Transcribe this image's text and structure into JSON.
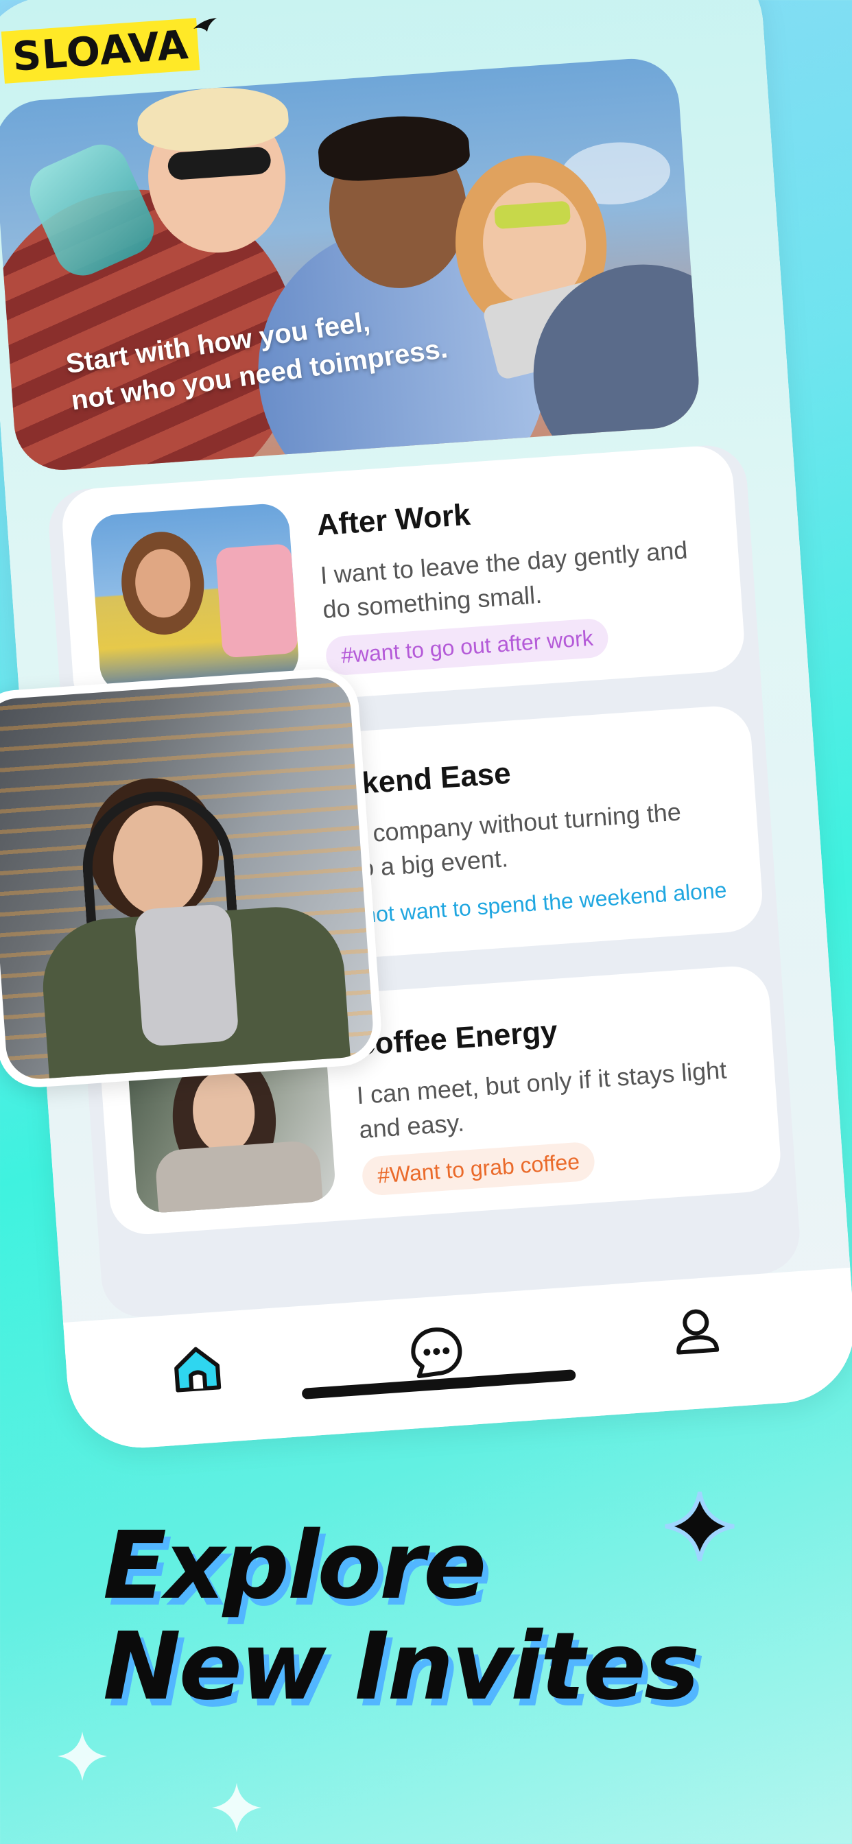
{
  "brand": {
    "logo_text": "SLOAVA"
  },
  "hero": {
    "caption_line1": "Start with how you feel,",
    "caption_line2": "not who you need toimpress."
  },
  "cards": [
    {
      "title": "After Work",
      "desc": "I want to leave the day gently and do something small.",
      "tag": "#want to  go out after work",
      "tag_color": "#b45ad8",
      "tag_bg": "#f4e6fa"
    },
    {
      "title": "eekend Ease",
      "desc": "ant company without turning the  into a big event.",
      "tag": "o not want to spend the weekend alone",
      "tag_color": "#1fa6e0",
      "tag_bg": "#ffffff"
    },
    {
      "title": "Coffee Energy",
      "desc": "I can meet, but only if it stays light and easy.",
      "tag": "#Want to grab coffee",
      "tag_color": "#ea6a2a",
      "tag_bg": "#fdeee6"
    }
  ],
  "tabbar": {
    "items": [
      {
        "icon": "home-icon"
      },
      {
        "icon": "chat-icon"
      },
      {
        "icon": "profile-icon"
      }
    ]
  },
  "headline": {
    "line1": "Explore",
    "line2": "New Invites"
  },
  "colors": {
    "accent_blue": "#52b6ff",
    "logo_yellow": "#ffe927",
    "home_fill": "#2fd6f0"
  }
}
